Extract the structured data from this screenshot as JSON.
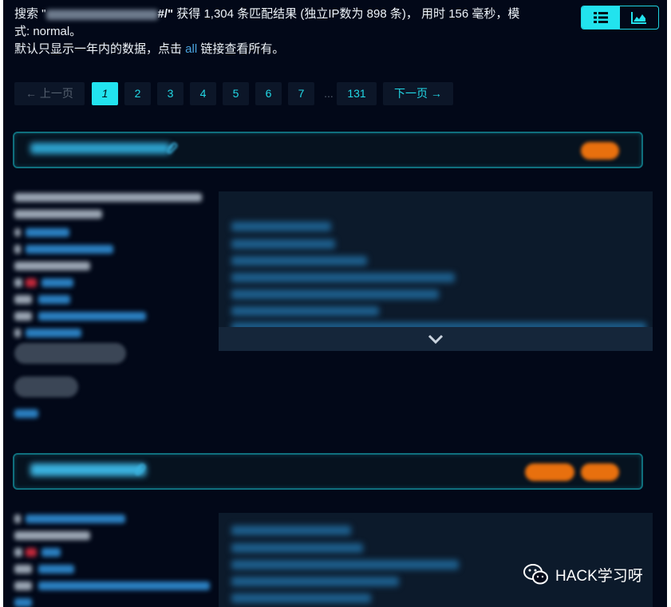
{
  "summary": {
    "prefix": "搜索 \"",
    "query_visible_end": "#/\"",
    "text_after_query": " 获得 1,304 条匹配结果 (独立IP数为 898 条)， 用时 156 毫秒，模式: normal。",
    "line2_prefix": "默认只显示一年内的数据，点击 ",
    "line2_link": "all",
    "line2_suffix": " 链接查看所有。"
  },
  "view_toggle": {
    "list_icon": "list-view-icon",
    "chart_icon": "chart-view-icon",
    "active": "list"
  },
  "pagination": {
    "prev": "← 上一页",
    "pages": [
      "1",
      "2",
      "3",
      "4",
      "5",
      "6",
      "7"
    ],
    "current": "1",
    "ellipsis": "...",
    "last": "131",
    "next": "下一页 →"
  },
  "colors": {
    "background": "#020818",
    "accent": "#22e3ee",
    "tag": "#e8700e",
    "link": "#4aa3df"
  },
  "results": [
    {
      "icon": "paperclip-icon",
      "tag_count": 1,
      "expand_icon": "chevron-down-icon"
    },
    {
      "icon": "paperclip-icon",
      "tag_count": 2
    }
  ],
  "watermark": {
    "icon": "wechat-icon",
    "text": "HACK学习呀"
  }
}
